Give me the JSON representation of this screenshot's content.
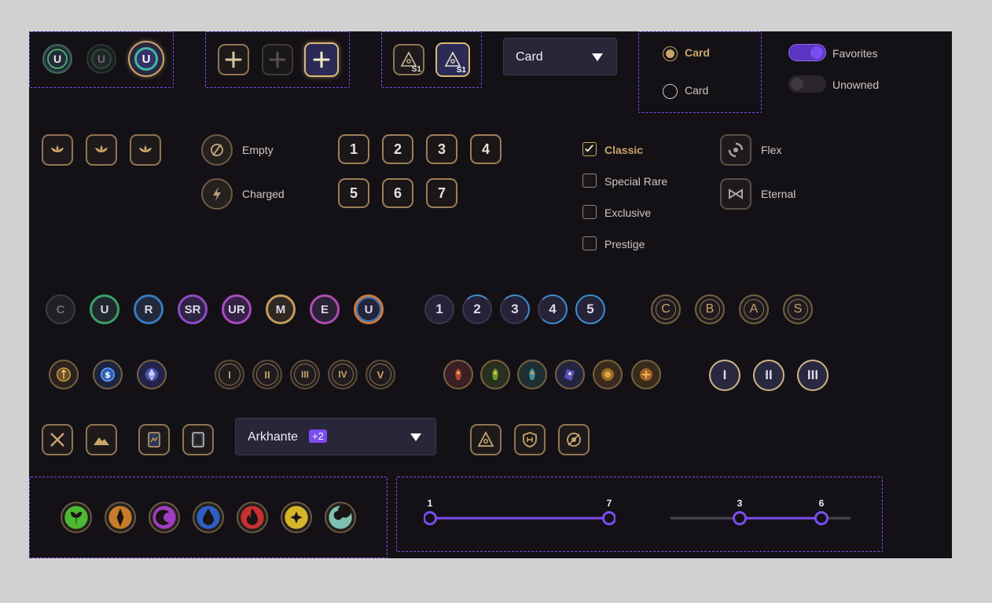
{
  "theme": {
    "background": "#141116",
    "accent": "#7b4cf0",
    "gold": "#c9a46a"
  },
  "badges_u": {
    "letter": "U"
  },
  "season": {
    "label": "S1"
  },
  "dropdown_card": {
    "value": "Card"
  },
  "radio": {
    "options": [
      {
        "label": "Card",
        "selected": true
      },
      {
        "label": "Card",
        "selected": false
      }
    ]
  },
  "toggles": [
    {
      "label": "Favorites",
      "on": true
    },
    {
      "label": "Unowned",
      "on": false
    }
  ],
  "states": [
    {
      "label": "Empty",
      "icon": "empty-slot-icon"
    },
    {
      "label": "Charged",
      "icon": "lightning-icon"
    }
  ],
  "cost_numbers": [
    "1",
    "2",
    "3",
    "4",
    "5",
    "6",
    "7"
  ],
  "rarity_filters": [
    {
      "label": "Classic",
      "checked": true
    },
    {
      "label": "Special Rare",
      "checked": false
    },
    {
      "label": "Exclusive",
      "checked": false
    },
    {
      "label": "Prestige",
      "checked": false
    }
  ],
  "formats": [
    {
      "label": "Flex",
      "icon": "flex-icon"
    },
    {
      "label": "Eternal",
      "icon": "eternal-icon"
    }
  ],
  "rarity_badges": [
    "C",
    "U",
    "R",
    "SR",
    "UR",
    "M",
    "E",
    "U"
  ],
  "level_badges": [
    "1",
    "2",
    "3",
    "4",
    "5"
  ],
  "tier_letters": [
    "C",
    "B",
    "A",
    "S"
  ],
  "roman_small": [
    "I",
    "II",
    "III",
    "IV",
    "V"
  ],
  "roman_large": [
    "I",
    "II",
    "III"
  ],
  "faction_dropdown": {
    "value": "Arkhante",
    "extra": "+2"
  },
  "elements": [
    {
      "name": "nature-element-icon",
      "color": "#4cb833"
    },
    {
      "name": "earth-element-icon",
      "color": "#c67c2a"
    },
    {
      "name": "shadow-element-icon",
      "color": "#9e3dc2"
    },
    {
      "name": "water-element-icon",
      "color": "#2e5fc6"
    },
    {
      "name": "fire-element-icon",
      "color": "#c93030"
    },
    {
      "name": "light-element-icon",
      "color": "#d6b629"
    },
    {
      "name": "air-element-icon",
      "color": "#7fc0b0"
    }
  ],
  "sliders": [
    {
      "min_label": "1",
      "max_label": "7",
      "low": 1,
      "high": 7,
      "range": [
        1,
        7
      ]
    },
    {
      "min_label": "3",
      "max_label": "6",
      "low": 3,
      "high": 6,
      "range": [
        1,
        7
      ]
    }
  ]
}
